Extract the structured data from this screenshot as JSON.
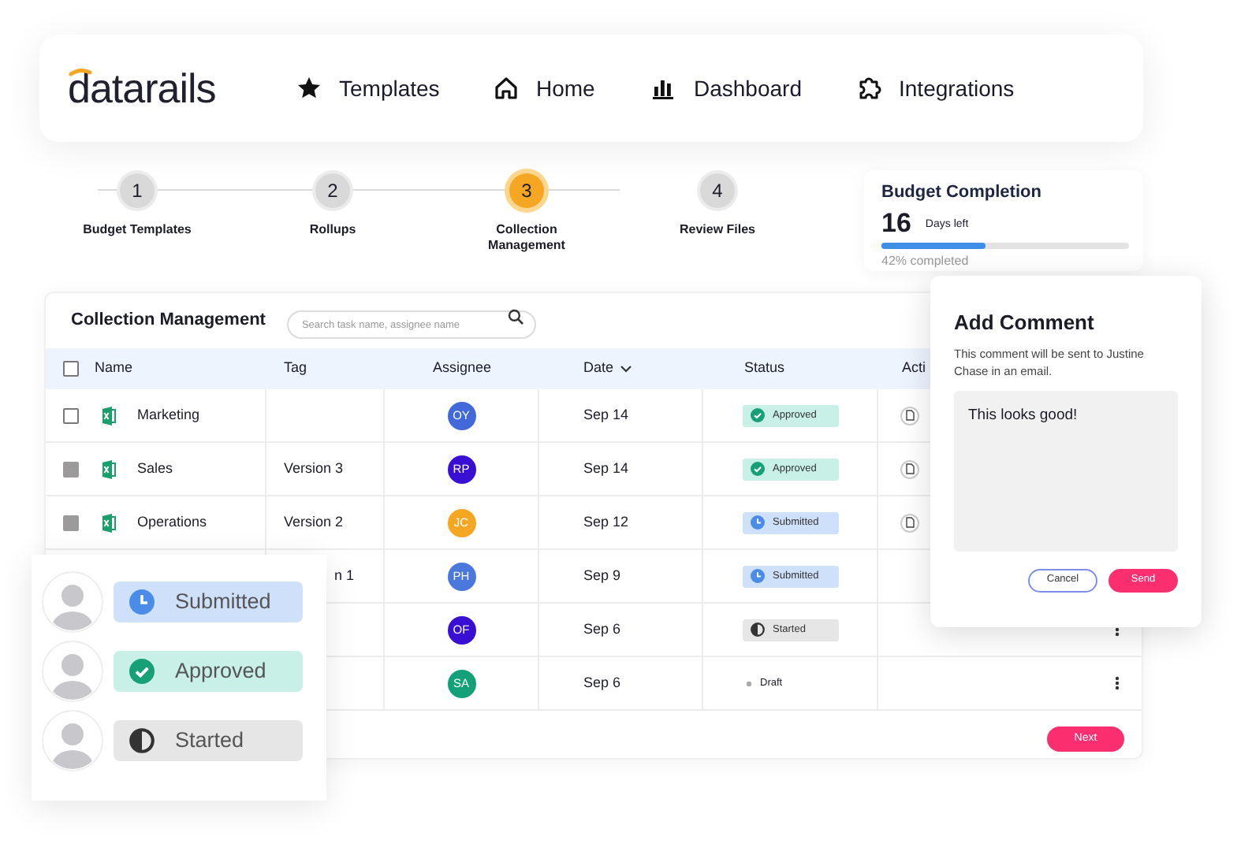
{
  "logo": "datarails",
  "nav": [
    {
      "label": "Templates"
    },
    {
      "label": "Home"
    },
    {
      "label": "Dashboard"
    },
    {
      "label": "Integrations"
    }
  ],
  "steps": [
    {
      "number": "1",
      "label": "Budget Templates",
      "selected": false
    },
    {
      "number": "2",
      "label": "Rollups",
      "selected": false
    },
    {
      "number": "3",
      "label": "Collection Management",
      "selected": true
    },
    {
      "number": "4",
      "label": "Review Files",
      "selected": false
    }
  ],
  "budget": {
    "title": "Budget Completion",
    "days": "16",
    "days_label": "Days left",
    "level": 0.42,
    "reading": "42% completed"
  },
  "table": {
    "title": "Collection Management",
    "search": {
      "placeholder": "Search task name, assignee name"
    },
    "header_checked": false,
    "columns": [
      "Name",
      "Tag",
      "Assignee",
      "Date",
      "Status",
      "Acti"
    ],
    "rows": [
      {
        "checked": false,
        "name": "Marketing",
        "assignee": "OY",
        "color": "#4169d9",
        "date": "Sep 14",
        "status": {
          "label": "Approved",
          "kind": "approved"
        },
        "file_action": true,
        "more_menu": false
      },
      {
        "checked": true,
        "name": "Sales",
        "tag": "Version 3",
        "assignee": "RP",
        "color": "#3a0fd4",
        "date": "Sep 14",
        "status": {
          "label": "Approved",
          "kind": "approved"
        },
        "file_action": true,
        "more_menu": false
      },
      {
        "checked": true,
        "name": "Operations",
        "tag": "Version 2",
        "assignee": "JC",
        "color": "#f5a623",
        "date": "Sep 12",
        "status": {
          "label": "Submitted",
          "kind": "submitted"
        },
        "file_action": true,
        "more_menu": false
      },
      {
        "tag": "n 1",
        "assignee": "PH",
        "color": "#4a78dc",
        "date": "Sep 9",
        "status": {
          "label": "Submitted",
          "kind": "submitted"
        },
        "file_action": false,
        "more_menu": false
      },
      {
        "assignee": "OF",
        "color": "#3a0fd4",
        "date": "Sep 6",
        "status": {
          "label": "Started",
          "kind": "started"
        },
        "file_action": false,
        "more_menu": true
      },
      {
        "assignee": "SA",
        "color": "#14a078",
        "date": "Sep 6",
        "status": {
          "label": "Draft",
          "kind": "draft"
        },
        "file_action": false,
        "more_menu": true
      }
    ],
    "next_button": "Next"
  },
  "comment_dialog": {
    "title": "Add Comment",
    "description": "This comment will be sent to Justine Chase in an email.",
    "value": "This looks good!",
    "buttons": [
      "Cancel",
      "Send"
    ]
  },
  "legend": [
    {
      "label": "Submitted",
      "kind": "submitted"
    },
    {
      "label": "Approved",
      "kind": "approved"
    },
    {
      "label": "Started",
      "kind": "started"
    }
  ]
}
